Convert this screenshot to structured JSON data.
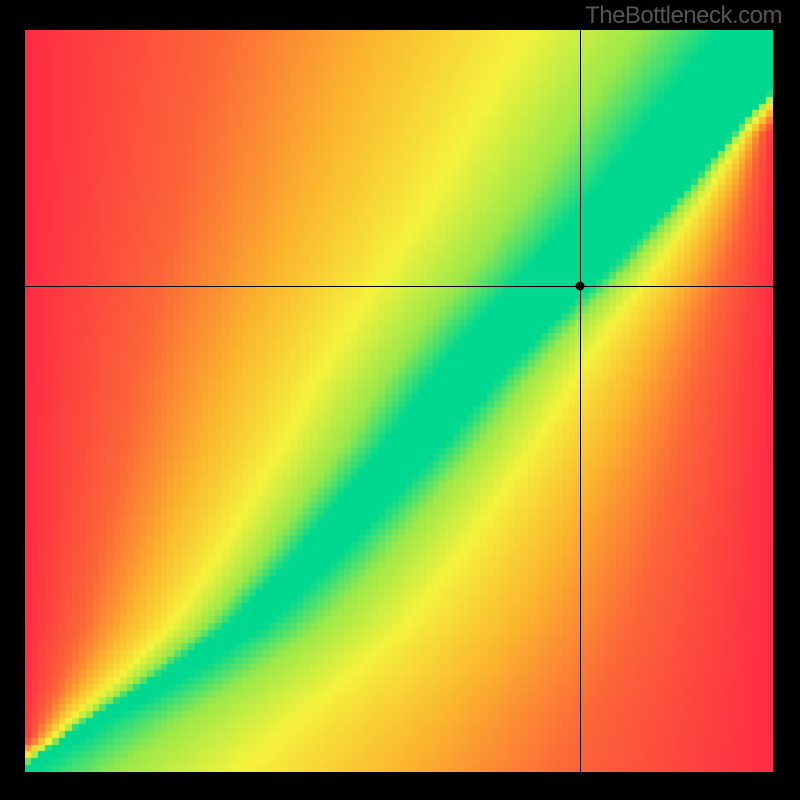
{
  "watermark": "TheBottleneck.com",
  "chart_data": {
    "type": "heatmap",
    "title": "",
    "xlabel": "",
    "ylabel": "",
    "xlim": [
      0,
      100
    ],
    "ylim": [
      0,
      100
    ],
    "grid": false,
    "legend": false,
    "crosshair": {
      "x": 74.2,
      "y": 65.5
    },
    "marker": {
      "x": 74.2,
      "y": 65.5
    },
    "optimal_curve": {
      "description": "Green optimal-balance ridge; points are (x, y) along it, with half-width of the green band in x-units.",
      "points": [
        {
          "x": 0,
          "y": 0,
          "half_width": 1.0
        },
        {
          "x": 10,
          "y": 7,
          "half_width": 1.5
        },
        {
          "x": 20,
          "y": 13,
          "half_width": 2.0
        },
        {
          "x": 30,
          "y": 20,
          "half_width": 2.5
        },
        {
          "x": 38,
          "y": 28,
          "half_width": 3.0
        },
        {
          "x": 45,
          "y": 36,
          "half_width": 3.5
        },
        {
          "x": 52,
          "y": 44,
          "half_width": 4.0
        },
        {
          "x": 58,
          "y": 52,
          "half_width": 4.5
        },
        {
          "x": 65,
          "y": 60,
          "half_width": 5.0
        },
        {
          "x": 73,
          "y": 68,
          "half_width": 5.5
        },
        {
          "x": 82,
          "y": 78,
          "half_width": 6.0
        },
        {
          "x": 90,
          "y": 88,
          "half_width": 6.5
        },
        {
          "x": 100,
          "y": 100,
          "half_width": 7.0
        }
      ]
    },
    "color_stops": {
      "description": "Color as a function of normalized distance from optimal curve (0=on ridge, 1=far).",
      "stops": [
        {
          "t": 0.0,
          "color": "#00D890"
        },
        {
          "t": 0.1,
          "color": "#00D890"
        },
        {
          "t": 0.2,
          "color": "#9AE84A"
        },
        {
          "t": 0.35,
          "color": "#F5F23C"
        },
        {
          "t": 0.55,
          "color": "#FBB52E"
        },
        {
          "t": 0.75,
          "color": "#FC6638"
        },
        {
          "t": 1.0,
          "color": "#FE2B44"
        }
      ]
    },
    "grid_resolution": 110
  }
}
